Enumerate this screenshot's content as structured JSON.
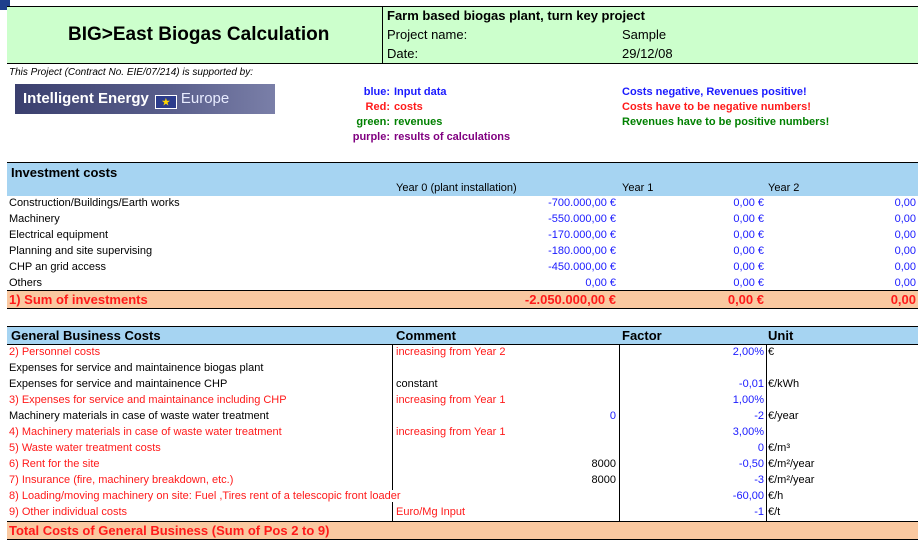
{
  "header": {
    "title": "BIG>East Biogas Calculation",
    "project_type": "Farm based biogas plant, turn key project",
    "project_name_label": "Project name:",
    "project_name_value": "Sample",
    "date_label": "Date:",
    "date_value": "29/12/08"
  },
  "support": {
    "note": "This Project (Contract No. EIE/07/214) is supported by:",
    "logo_text": "Intelligent Energy",
    "logo_region": "Europe"
  },
  "legend": {
    "blue_key": "blue:",
    "blue_value": "Input data",
    "red_key": "Red:",
    "red_value": "costs",
    "green_key": "green:",
    "green_value": "revenues",
    "purple_key": "purple:",
    "purple_value": "results of calculations"
  },
  "notes": {
    "line1": "Costs negative, Revenues positive!",
    "line2": "Costs have to be negative numbers!",
    "line3": "Revenues have to be positive numbers!"
  },
  "investment": {
    "title": "Investment costs",
    "col_year0": "Year 0 (plant installation)",
    "col_year1": "Year 1",
    "col_year2": "Year 2",
    "rows": [
      {
        "label": "Construction/Buildings/Earth works",
        "y0": "-700.000,00 €",
        "y1": "0,00 €",
        "y2": "0,00"
      },
      {
        "label": "Machinery",
        "y0": "-550.000,00 €",
        "y1": "0,00 €",
        "y2": "0,00"
      },
      {
        "label": "Electrical equipment",
        "y0": "-170.000,00 €",
        "y1": "0,00 €",
        "y2": "0,00"
      },
      {
        "label": "Planning and site supervising",
        "y0": "-180.000,00 €",
        "y1": "0,00 €",
        "y2": "0,00"
      },
      {
        "label": "CHP an grid access",
        "y0": "-450.000,00 €",
        "y1": "0,00 €",
        "y2": "0,00"
      },
      {
        "label": "Others",
        "y0": "0,00 €",
        "y1": "0,00 €",
        "y2": "0,00"
      }
    ],
    "sum_label": "1) Sum of investments",
    "sum_y0": "-2.050.000,00 €",
    "sum_y1": "0,00 €",
    "sum_y2": "0,00"
  },
  "gbc": {
    "title": "General Business Costs",
    "col_comment": "Comment",
    "col_factor": "Factor",
    "col_unit": "Unit",
    "rows": [
      {
        "label": "2) Personnel costs",
        "comment": "increasing from Year 2",
        "factor_input": "",
        "factor": "2,00%",
        "unit": "€",
        "red": true
      },
      {
        "label": "Expenses for service and maintainence biogas plant",
        "comment": "",
        "factor_input": "",
        "factor": "",
        "unit": "",
        "red": false
      },
      {
        "label": "Expenses for service and maintainence CHP",
        "comment": "constant",
        "factor_input": "",
        "factor": "-0,01",
        "unit": "€/kWh",
        "red": false
      },
      {
        "label": "3) Expenses for service and maintainance including CHP",
        "comment": "increasing from Year 1",
        "factor_input": "",
        "factor": "1,00%",
        "unit": "",
        "red": true
      },
      {
        "label": "Machinery materials in case of waste water treatment",
        "comment": "",
        "factor_input": "0",
        "factor": "-2",
        "unit": "€/year",
        "red": false
      },
      {
        "label": "4) Machinery materials in case of waste water treatment",
        "comment": "increasing from Year 1",
        "factor_input": "",
        "factor": "3,00%",
        "unit": "",
        "red": true
      },
      {
        "label": "5) Waste water treatment costs",
        "comment": "",
        "factor_input": "",
        "factor": "0",
        "unit": "€/m³",
        "red": true
      },
      {
        "label": "6)  Rent for the site",
        "comment": "",
        "factor_input": "8000",
        "factor": "-0,50",
        "unit": "€/m²/year",
        "red": true
      },
      {
        "label": "7)  Insurance (fire, machinery breakdown,  etc.)",
        "comment": "",
        "factor_input": "8000",
        "factor": "-3",
        "unit": "€/m²/year",
        "red": true
      },
      {
        "label": "8) Loading/moving machinery on site: Fuel ,Tires rent of a telescopic front loader",
        "comment": "",
        "factor_input": "",
        "factor": "-60,00",
        "unit": "€/h",
        "red": true
      },
      {
        "label": "9) Other individual costs",
        "comment": "Euro/Mg Input",
        "factor_input": "",
        "factor": "-1",
        "unit": "€/t",
        "red": true
      }
    ],
    "total_label": "Total Costs of General Business (Sum of Pos 2 to 9)"
  }
}
